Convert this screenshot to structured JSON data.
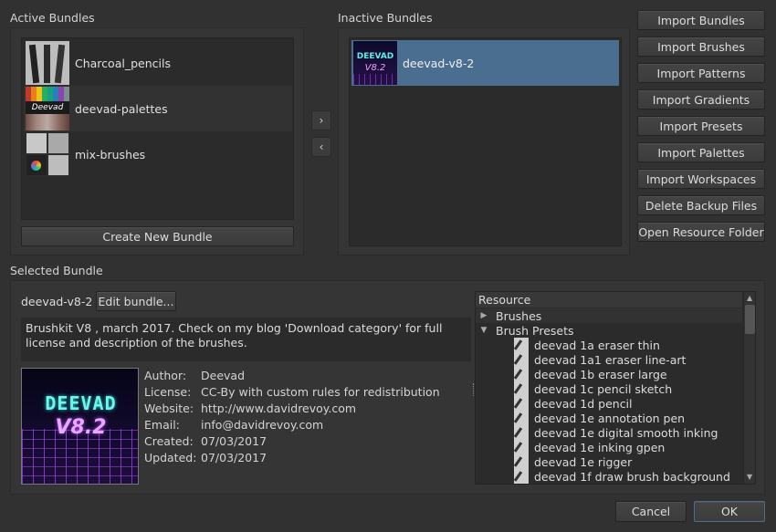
{
  "active": {
    "title": "Active Bundles",
    "items": [
      {
        "label": "Charcoal_pencils"
      },
      {
        "label": "deevad-palettes"
      },
      {
        "label": "mix-brushes"
      }
    ],
    "create_button": "Create New Bundle"
  },
  "inactive": {
    "title": "Inactive Bundles",
    "items": [
      {
        "label": "deevad-v8-2"
      }
    ]
  },
  "transfer": {
    "right": "›",
    "left": "‹"
  },
  "import_buttons": [
    "Import Bundles",
    "Import Brushes",
    "Import Patterns",
    "Import Gradients",
    "Import Presets",
    "Import Palettes",
    "Import Workspaces",
    "Delete Backup Files",
    "Open Resource Folder"
  ],
  "selected": {
    "title": "Selected Bundle",
    "name": "deevad-v8-2",
    "edit_button": "Edit bundle...",
    "description": "Brushkit V8 , march 2017. Check on my blog 'Download category' for full license and description of the brushes.",
    "logo_line1": "DEEVAD",
    "logo_line2": "V8.2",
    "meta": {
      "author_k": "Author:",
      "author_v": "Deevad",
      "license_k": "License:",
      "license_v": "CC-By with custom rules for redistribution",
      "website_k": "Website:",
      "website_v": "http://www.davidrevoy.com",
      "email_k": "Email:",
      "email_v": "info@davidrevoy.com",
      "created_k": "Created:",
      "created_v": "07/03/2017",
      "updated_k": "Updated:",
      "updated_v": "07/03/2017"
    }
  },
  "resource_tree": {
    "header": "Resource",
    "groups": [
      {
        "label": "Brushes",
        "expanded": false
      },
      {
        "label": "Brush Presets",
        "expanded": true
      }
    ],
    "presets": [
      "deevad 1a eraser thin",
      "deevad 1a1 eraser line-art",
      "deevad 1b eraser large",
      "deevad 1c pencil sketch",
      "deevad 1d pencil",
      "deevad 1e annotation pen",
      "deevad 1e digital smooth inking",
      "deevad 1e inking gpen",
      "deevad 1e rigger",
      "deevad 1f draw brush background"
    ]
  },
  "footer": {
    "cancel": "Cancel",
    "ok": "OK"
  }
}
